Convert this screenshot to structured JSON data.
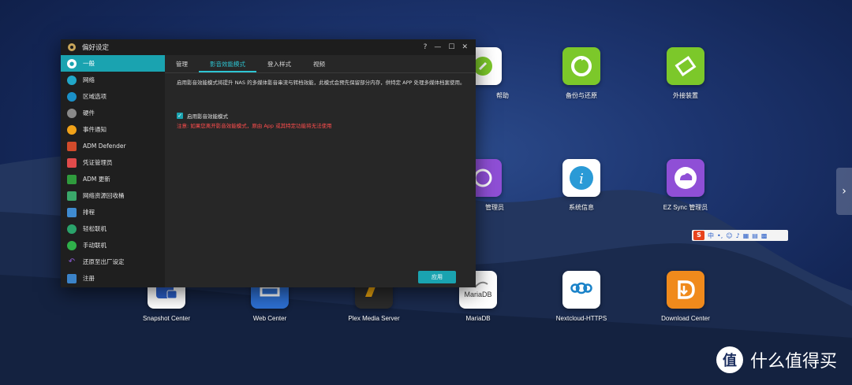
{
  "window": {
    "title": "偏好设定",
    "controls": [
      "?",
      "—",
      "☐",
      "✕"
    ]
  },
  "sidebar": {
    "items": [
      {
        "label": "一般",
        "icon": "general-icon",
        "color": "#1aa3b0",
        "active": true
      },
      {
        "label": "网络",
        "icon": "network-icon",
        "color": "#21a7c8"
      },
      {
        "label": "区域选项",
        "icon": "region-icon",
        "color": "#1a90c8"
      },
      {
        "label": "硬件",
        "icon": "hardware-icon",
        "color": "#8a8a8a"
      },
      {
        "label": "事件通知",
        "icon": "notification-icon",
        "color": "#f1a219"
      },
      {
        "label": "ADM Defender",
        "icon": "defender-icon",
        "color": "#d24b2b"
      },
      {
        "label": "凭证管理员",
        "icon": "certificate-icon",
        "color": "#e14b4b"
      },
      {
        "label": "ADM 更新",
        "icon": "update-icon",
        "color": "#2f9b3d"
      },
      {
        "label": "网络资源回收桶",
        "icon": "recycle-bin-icon",
        "color": "#3aa86a"
      },
      {
        "label": "排程",
        "icon": "schedule-icon",
        "color": "#3f8bd0"
      },
      {
        "label": "轻松联机",
        "icon": "ezconnect-icon",
        "color": "#2aa36b"
      },
      {
        "label": "手动联机",
        "icon": "manual-connect-icon",
        "color": "#2fb04a"
      },
      {
        "label": "还原至出厂设定",
        "icon": "reset-icon",
        "color": "#8e5bd6"
      },
      {
        "label": "注册",
        "icon": "register-icon",
        "color": "#3b83c8"
      }
    ]
  },
  "tabs": [
    {
      "label": "管理"
    },
    {
      "label": "影音效能模式",
      "active": true
    },
    {
      "label": "登入样式"
    },
    {
      "label": "视频"
    }
  ],
  "main": {
    "description": "启用影音效能模式将提升 NAS 的多媒体影音串流与转档效能，此模式会预先保留部分内存，供特定 APP 处理多媒体档案使用。",
    "checkbox_label": "启用影音效能模式",
    "checkbox_checked": true,
    "warning": "注意: 如果您离开影音效能模式，原由 App 或其特定功能将无法使用",
    "apply_label": "应用"
  },
  "desktop": {
    "icons": [
      {
        "label": "帮助",
        "icon": "help-icon",
        "color": "#ffffff"
      },
      {
        "label": "备份与还原",
        "icon": "backup-restore-icon",
        "color": "#7cc82a"
      },
      {
        "label": "外接装置",
        "icon": "external-device-icon",
        "color": "#7cc82a"
      },
      {
        "label": "管理员",
        "icon": "admin-icon",
        "color": "#8f4fd6"
      },
      {
        "label": "系统信息",
        "icon": "system-info-icon",
        "color": "#ffffff"
      },
      {
        "label": "EZ Sync 管理员",
        "icon": "ezsync-icon",
        "color": "#8f4fd6"
      },
      {
        "label": "Snapshot Center",
        "icon": "snapshot-icon",
        "color": "#ffffff"
      },
      {
        "label": "Web Center",
        "icon": "web-center-icon",
        "color": "#2d6fd1"
      },
      {
        "label": "Plex Media Server",
        "icon": "plex-icon",
        "color": "#2b2b2b"
      },
      {
        "label": "MariaDB",
        "icon": "mariadb-icon",
        "color": "#ffffff"
      },
      {
        "label": "Nextcloud-HTTPS",
        "icon": "nextcloud-icon",
        "color": "#ffffff"
      },
      {
        "label": "Download Center",
        "icon": "download-center-icon",
        "color": "#f08a1c"
      }
    ]
  },
  "ime_toolbar": {
    "logo": "S",
    "mode": "中"
  },
  "watermark": {
    "text": "什么值得买",
    "logo": "值"
  }
}
